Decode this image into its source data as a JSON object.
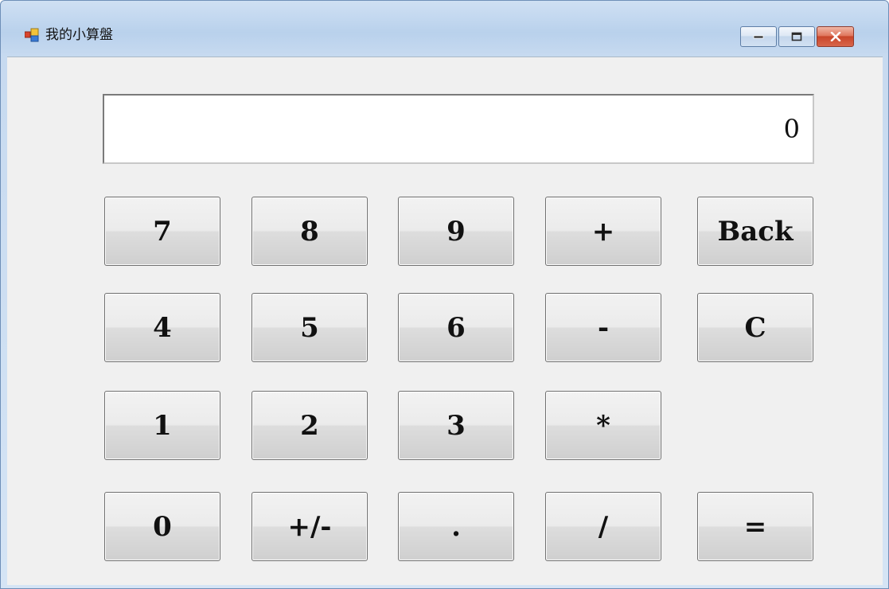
{
  "window": {
    "title": "我的小算盤",
    "icon": "app-window-icon",
    "caption_buttons": [
      "minimize-icon",
      "maximize-icon",
      "close-icon"
    ],
    "close_color": "#c8452a"
  },
  "display": {
    "value": "0"
  },
  "keypad": {
    "row1": [
      "7",
      "8",
      "9",
      "+",
      "Back"
    ],
    "row2": [
      "4",
      "5",
      "6",
      "-",
      "C"
    ],
    "row3": [
      "1",
      "2",
      "3",
      "*"
    ],
    "row4": [
      "0",
      "+/-",
      ".",
      "/",
      "="
    ]
  }
}
